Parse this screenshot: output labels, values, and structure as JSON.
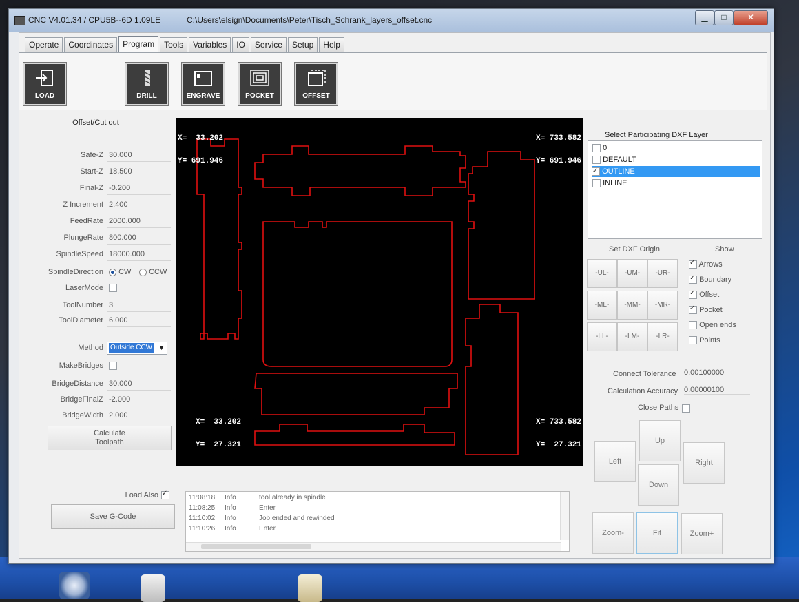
{
  "window": {
    "title": "CNC V4.01.34 / CPU5B--6D 1.09LE",
    "path": "C:\\Users\\elsign\\Documents\\Peter\\Tisch_Schrank_layers_offset.cnc",
    "minimize": "▁",
    "maximize": "□",
    "close": "✕"
  },
  "tabs": [
    "Operate",
    "Coordinates",
    "Program",
    "Tools",
    "Variables",
    "IO",
    "Service",
    "Setup",
    "Help"
  ],
  "active_tab": "Program",
  "toolbar": {
    "load": "LOAD",
    "drill": "DRILL",
    "engrave": "ENGRAVE",
    "pocket": "POCKET",
    "offset": "OFFSET"
  },
  "left": {
    "title": "Offset/Cut out",
    "fields": [
      {
        "label": "Safe-Z",
        "value": "30.000"
      },
      {
        "label": "Start-Z",
        "value": "18.500"
      },
      {
        "label": "Final-Z",
        "value": "-0.200"
      },
      {
        "label": "Z Increment",
        "value": "2.400"
      },
      {
        "label": "FeedRate",
        "value": "2000.000"
      },
      {
        "label": "PlungeRate",
        "value": "800.000"
      },
      {
        "label": "SpindleSpeed",
        "value": "18000.000"
      }
    ],
    "spindle_direction_label": "SpindleDirection",
    "cw_label": "CW",
    "ccw_label": "CCW",
    "laser_mode_label": "LaserMode",
    "tool_number_label": "ToolNumber",
    "tool_number": "3",
    "tool_diameter_label": "ToolDiameter",
    "tool_diameter": "6.000",
    "method_label": "Method",
    "method_value": "Outside CCW",
    "make_bridges_label": "MakeBridges",
    "bridge_fields": [
      {
        "label": "BridgeDistance",
        "value": "30.000"
      },
      {
        "label": "BridgeFinalZ",
        "value": "-2.000"
      },
      {
        "label": "BridgeWidth",
        "value": "2.000"
      }
    ],
    "calculate_label_1": "Calculate",
    "calculate_label_2": "Toolpath",
    "load_also_label": "Load Also",
    "save_gcode_label": "Save G-Code"
  },
  "canvas": {
    "top_left_x": "X=  33.202",
    "top_left_y": "Y= 691.946",
    "top_right_x": "X= 733.582",
    "top_right_y": "Y= 691.946",
    "bottom_left_x": "X=  33.202",
    "bottom_left_y": "Y=  27.321",
    "bottom_right_x": "X= 733.582",
    "bottom_right_y": "Y=  27.321",
    "path_color": "#e01010"
  },
  "log": [
    {
      "time": "11:08:18",
      "level": "Info",
      "msg": "tool already in spindle"
    },
    {
      "time": "11:08:25",
      "level": "Info",
      "msg": "Enter"
    },
    {
      "time": "11:10:02",
      "level": "Info",
      "msg": "Job ended and rewinded"
    },
    {
      "time": "11:10:26",
      "level": "Info",
      "msg": "Enter"
    }
  ],
  "right": {
    "layer_title": "Select Participating DXF Layer",
    "layers": [
      {
        "name": "0",
        "checked": false,
        "selected": false
      },
      {
        "name": "DEFAULT",
        "checked": false,
        "selected": false
      },
      {
        "name": "OUTLINE",
        "checked": true,
        "selected": true
      },
      {
        "name": "INLINE",
        "checked": false,
        "selected": false
      }
    ],
    "origin_title": "Set DXF Origin",
    "origin_buttons": [
      "-UL-",
      "-UM-",
      "-UR-",
      "-ML-",
      "-MM-",
      "-MR-",
      "-LL-",
      "-LM-",
      "-LR-"
    ],
    "show_title": "Show",
    "show_items": [
      {
        "label": "Arrows",
        "checked": true
      },
      {
        "label": "Boundary",
        "checked": true
      },
      {
        "label": "Offset",
        "checked": true
      },
      {
        "label": "Pocket",
        "checked": true
      },
      {
        "label": "Open ends",
        "checked": false
      },
      {
        "label": "Points",
        "checked": false
      }
    ],
    "connect_tolerance_label": "Connect Tolerance",
    "connect_tolerance": "0.00100000",
    "calc_accuracy_label": "Calculation Accuracy",
    "calc_accuracy": "0.00000100",
    "close_paths_label": "Close Paths",
    "nav": {
      "up": "Up",
      "left": "Left",
      "right": "Right",
      "down": "Down"
    },
    "zoom_minus": "Zoom-",
    "fit": "Fit",
    "zoom_plus": "Zoom+"
  }
}
